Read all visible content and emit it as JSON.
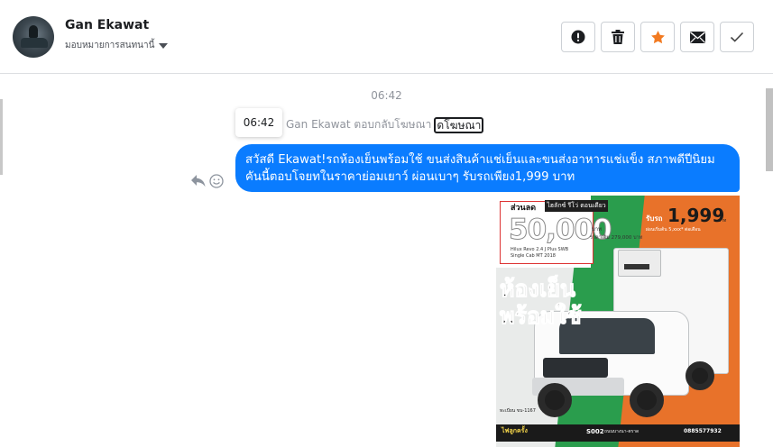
{
  "header": {
    "contact_name": "Gan Ekawat",
    "assign_label": "มอบหมายการสนทนานี้",
    "actions": [
      {
        "name": "report-spam-button",
        "icon": "alert-circle-icon"
      },
      {
        "name": "delete-button",
        "icon": "trash-icon"
      },
      {
        "name": "star-button",
        "icon": "star-icon"
      },
      {
        "name": "mark-unread-button",
        "icon": "envelope-icon"
      },
      {
        "name": "mark-done-button",
        "icon": "checkmark-icon"
      }
    ]
  },
  "conversation": {
    "timestamp": "06:42",
    "tooltip_time": "06:42",
    "replied_text": "Gan Ekawat ตอบกลับโฆษณา",
    "replied_link": "ดโฆษณา",
    "message_text": "สวัสดี Ekawat!รถห้องเย็นพร้อมใช้ ขนส่งสินค้าแช่เย็นและขนส่งอาหารแช่แข็ง สภาพดีปีนิยม คันนี้ตอบโจยทในราคาย่อมเยาว์ ผ่อนเบาๆ รับรถเพียง1,999 บาท"
  },
  "ad_image": {
    "sale_label": "ส่วนลด",
    "top_strip": "ไฮลักซ์ รีโว่ ตอนเดียว",
    "sale_amount": "50,000",
    "sale_unit": "บาท",
    "sale_price": "ราคาเต็ม 279,000 บาท",
    "model": "Hilux Revo 2.4 J Plus SWB Single Cab MT 2018",
    "rent_label": "รับรถ",
    "rent_amount": "1,999",
    "rent_unit": "บาท",
    "rent_sub": "ผ่อนเริ่มต้น 5,xxx* ต่อเดือน",
    "headline_1": "ห้องเย็น",
    "headline_2": "พร้อมใช้",
    "license": "ทะเบียน ขบ-1167",
    "brand": "ไฟลูกครั้ง",
    "stock_id": "S002",
    "address": "ถนนบางนา-ตราด",
    "phone": "0885577932"
  }
}
